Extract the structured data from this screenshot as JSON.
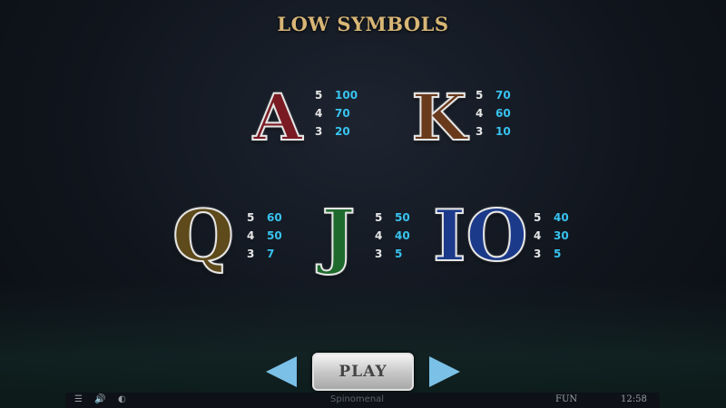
{
  "title": "LOW SYMBOLS",
  "symbols": [
    {
      "glyph": "A",
      "fill": "#7a1a22",
      "pays": [
        {
          "count": "5",
          "value": "100"
        },
        {
          "count": "4",
          "value": "70"
        },
        {
          "count": "3",
          "value": "20"
        }
      ]
    },
    {
      "glyph": "K",
      "fill": "#6a3a1c",
      "pays": [
        {
          "count": "5",
          "value": "70"
        },
        {
          "count": "4",
          "value": "60"
        },
        {
          "count": "3",
          "value": "10"
        }
      ]
    },
    {
      "glyph": "Q",
      "fill": "#5e4a1a",
      "pays": [
        {
          "count": "5",
          "value": "60"
        },
        {
          "count": "4",
          "value": "50"
        },
        {
          "count": "3",
          "value": "7"
        }
      ]
    },
    {
      "glyph": "J",
      "fill": "#1e6a2c",
      "pays": [
        {
          "count": "5",
          "value": "50"
        },
        {
          "count": "4",
          "value": "40"
        },
        {
          "count": "3",
          "value": "5"
        }
      ]
    },
    {
      "glyph": "IO",
      "fill": "#1c3a8a",
      "pays": [
        {
          "count": "5",
          "value": "40"
        },
        {
          "count": "4",
          "value": "30"
        },
        {
          "count": "3",
          "value": "5"
        }
      ]
    }
  ],
  "nav": {
    "play_label": "PLAY"
  },
  "bottom_bar": {
    "brand": "Spinomenal",
    "mode": "FUN",
    "time": "12:58",
    "menu_icon": "menu-icon",
    "sound_icon": "sound-icon",
    "speed_icon": "speed-icon"
  },
  "colors": {
    "title": "#d8b676",
    "pay_value": "#38c3f0",
    "arrow": "#7bc0e6"
  }
}
